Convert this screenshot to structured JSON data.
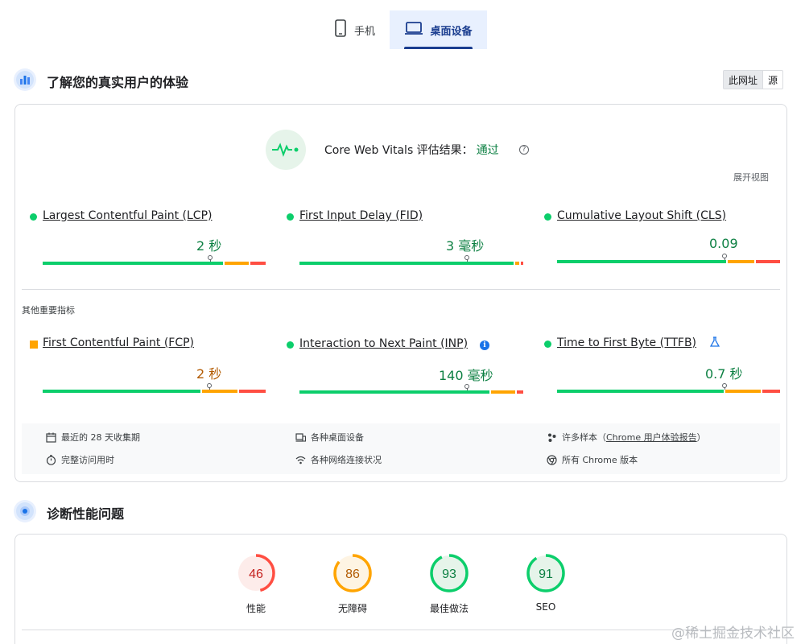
{
  "tabs": [
    {
      "label": "手机",
      "icon": "phone-icon",
      "active": false
    },
    {
      "label": "桌面设备",
      "icon": "laptop-icon",
      "active": true
    }
  ],
  "field_section": {
    "title": "了解您的真实用户的体验",
    "source_toggle": [
      "此网址",
      "源"
    ]
  },
  "cwv": {
    "title": "Core Web Vitals 评估结果：",
    "status": "通过",
    "help": "?",
    "expand_label": "展开视图"
  },
  "core_metrics": [
    {
      "name": "Largest Contentful Paint (LCP)",
      "value": "2 秒",
      "rating": "good",
      "distribution": [
        0.82,
        0.11,
        0.07
      ]
    },
    {
      "name": "First Input Delay (FID)",
      "value": "3 毫秒",
      "rating": "good",
      "distribution": [
        0.97,
        0.02,
        0.01
      ]
    },
    {
      "name": "Cumulative Layout Shift (CLS)",
      "value": "0.09",
      "rating": "good",
      "distribution": [
        0.77,
        0.12,
        0.11
      ]
    }
  ],
  "other_label": "其他重要指标",
  "other_metrics": [
    {
      "name": "First Contentful Paint (FCP)",
      "value": "2 秒",
      "rating": "average",
      "distribution": [
        0.72,
        0.16,
        0.12
      ]
    },
    {
      "name": "Interaction to Next Paint (INP)",
      "value": "140 毫秒",
      "rating": "good",
      "distribution": [
        0.86,
        0.11,
        0.03
      ],
      "info": "i"
    },
    {
      "name": "Time to First Byte (TTFB)",
      "value": "0.7 秒",
      "rating": "good",
      "distribution": [
        0.76,
        0.16,
        0.08
      ],
      "experimental": true
    }
  ],
  "footer": {
    "collection_period": "最近的 28 天收集期",
    "duration": "完整访问用时",
    "devices": "各种桌面设备",
    "network": "各种网络连接状况",
    "samples_prefix": "许多样本（",
    "samples_link": "Chrome 用户体验报告",
    "samples_suffix": "）",
    "chrome_versions": "所有 Chrome 版本"
  },
  "diagnose_section": {
    "title": "诊断性能问题"
  },
  "scores": [
    {
      "label": "性能",
      "score": "46",
      "color": "#ff4e42",
      "bg": "#fdecea",
      "text_color": "#c5221f",
      "fraction": 0.46
    },
    {
      "label": "无障碍",
      "score": "86",
      "color": "#ffa400",
      "bg": "#fef4e3",
      "text_color": "#b25a00",
      "fraction": 0.86
    },
    {
      "label": "最佳做法",
      "score": "93",
      "color": "#0cce6b",
      "bg": "#e6f4ea",
      "text_color": "#0d8043",
      "fraction": 0.93
    },
    {
      "label": "SEO",
      "score": "91",
      "color": "#0cce6b",
      "bg": "#e6f4ea",
      "text_color": "#0d8043",
      "fraction": 0.91
    }
  ],
  "watermark": "@稀土掘金技术社区"
}
